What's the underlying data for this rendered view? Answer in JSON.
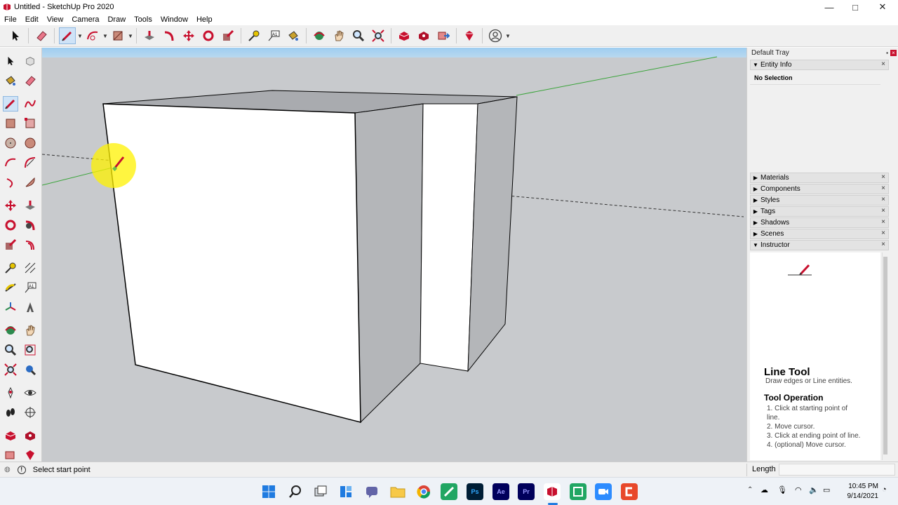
{
  "window": {
    "title": "Untitled - SketchUp Pro 2020",
    "minimize": "—",
    "maximize": "□",
    "close": "✕"
  },
  "menu": [
    "File",
    "Edit",
    "View",
    "Camera",
    "Draw",
    "Tools",
    "Window",
    "Help"
  ],
  "tray": {
    "title": "Default Tray",
    "entity_info": {
      "label": "Entity Info",
      "selection": "No Selection"
    },
    "panels": [
      "Materials",
      "Components",
      "Styles",
      "Tags",
      "Shadows",
      "Scenes"
    ],
    "instructor": {
      "label": "Instructor",
      "tool_title": "Line Tool",
      "tool_desc": "Draw edges or Line entities.",
      "operation_title": "Tool Operation",
      "steps": [
        "1. Click at starting point of line.",
        "2. Move cursor.",
        "3. Click at ending point of line.",
        "4. (optional) Move cursor."
      ]
    }
  },
  "status": {
    "message": "Select start point",
    "measure_label": "Length",
    "measure_value": ""
  },
  "taskbar": {
    "apps": [
      "Ps",
      "Ae",
      "Pr"
    ],
    "time": "10:45 PM",
    "date": "9/14/2021"
  },
  "colors": {
    "accent_red": "#c8102e",
    "viewport_bg": "#c8cacd",
    "sky": "#9ecdf0",
    "green_axis": "#3aa43a",
    "highlight": "#fff200"
  }
}
